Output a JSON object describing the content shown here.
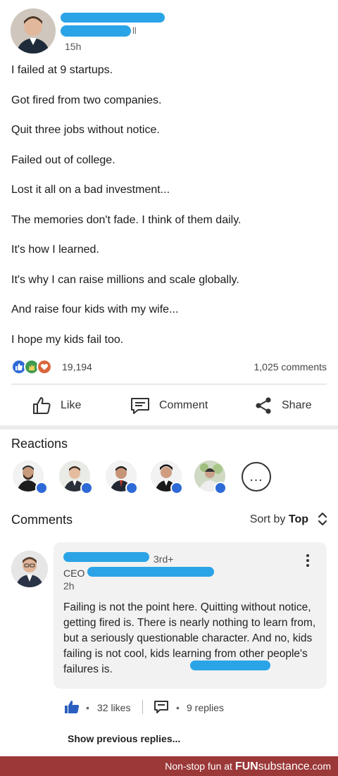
{
  "post": {
    "author_name_suffix": "ll",
    "timestamp": "15h",
    "lines": [
      "I failed at 9 startups.",
      "Got fired from two companies.",
      "Quit three jobs without notice.",
      "Failed out of college.",
      "Lost it all on a bad investment...",
      "The memories don't fade. I think of them daily.",
      "It's how I learned.",
      "It's why I can raise millions and scale globally.",
      "And raise four kids with my wife...",
      "I hope my kids fail too."
    ],
    "reaction_count": "19,194",
    "comment_count": "1,025 comments",
    "reaction_types": [
      "like-icon",
      "celebrate-icon",
      "love-icon"
    ]
  },
  "actions": {
    "like": "Like",
    "comment": "Comment",
    "share": "Share"
  },
  "reactions": {
    "title": "Reactions",
    "more": "…"
  },
  "comments": {
    "title": "Comments",
    "sort_prefix": "Sort by",
    "sort_value": "Top",
    "items": [
      {
        "degree": "3rd+",
        "headline_prefix": "CEO",
        "time": "2h",
        "text": "Failing is not the point here. Quitting without notice, getting fired is. There is nearly nothing to learn from, but a seriously questionable character. And no, kids failing is not cool, kids learning from other people's failures is.",
        "likes": "32 likes",
        "replies": "9 replies"
      }
    ],
    "show_previous": "Show previous replies..."
  },
  "footer": {
    "prefix": "Non-stop fun at",
    "brand_fun": "FUN",
    "brand_rest": "substance",
    "brand_tld": ".com"
  },
  "colors": {
    "accent_blue": "#2d6ad6",
    "redaction": "#2aa4e6",
    "footer_bg": "#9b3838"
  }
}
